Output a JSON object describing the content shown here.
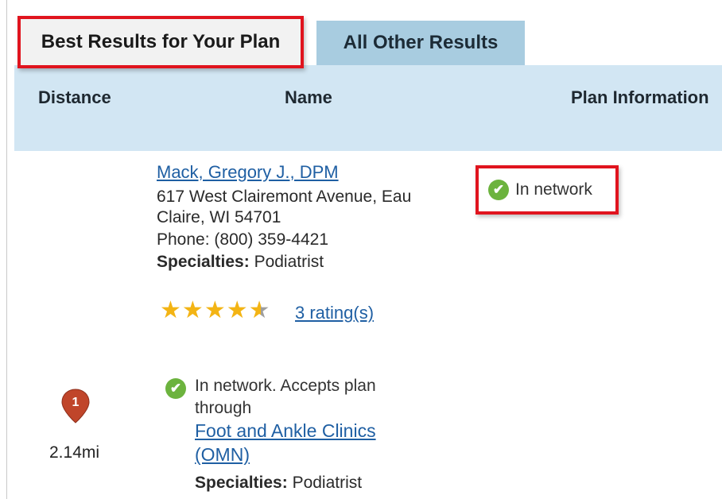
{
  "tabs": {
    "best": "Best Results for Your Plan",
    "other": "All Other Results"
  },
  "columns": {
    "distance": "Distance",
    "name": "Name",
    "plan": "Plan Information"
  },
  "result1": {
    "name": "Mack, Gregory J., DPM",
    "address_line1": "617 West Clairemont Avenue, Eau",
    "address_line2": "Claire, WI 54701",
    "phone": "Phone: (800) 359-4421",
    "specialties_label": "Specialties:",
    "specialties_value": " Podiatrist",
    "network_status": "In network",
    "rating_stars": 4.5,
    "ratings_link": "3 rating(s)"
  },
  "result2": {
    "pin_number": "1",
    "distance": "2.14mi",
    "network_line1": "In network. Accepts plan",
    "network_line2": "through",
    "clinic_line1": "Foot and Ankle Clinics",
    "clinic_line2": "(OMN)",
    "specialties_label": "Specialties:",
    "specialties_value": " Podiatrist"
  },
  "colors": {
    "highlight": "#e0141e",
    "link": "#1f5fa3",
    "header": "#d2e6f3",
    "check": "#6cb33e",
    "star": "#f3b414",
    "pin": "#c0452a"
  }
}
